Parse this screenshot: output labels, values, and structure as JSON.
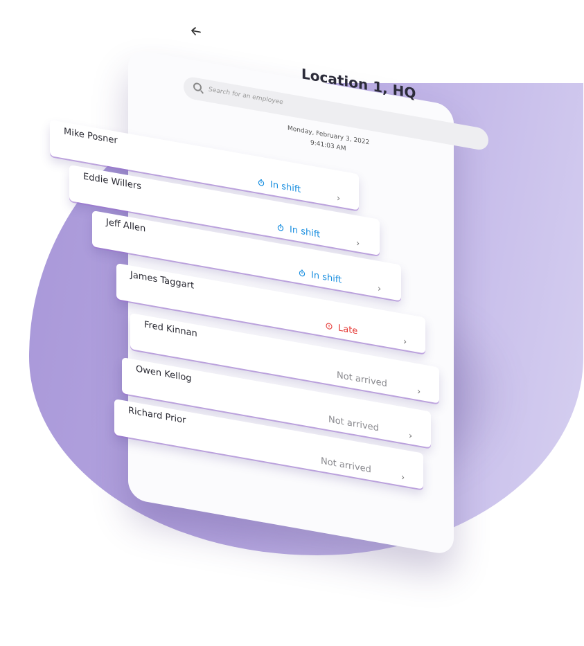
{
  "header": {
    "title": "Location 1, HQ",
    "back_icon": "back-arrow-icon"
  },
  "search": {
    "placeholder": "Search for an employee",
    "icon": "search-icon"
  },
  "datetime": {
    "date": "Monday, February 3, 2022",
    "time": "9:41:03 AM"
  },
  "employees": [
    {
      "name": "Mike Posner",
      "status": "In shift",
      "status_type": "inshift"
    },
    {
      "name": "Eddie Willers",
      "status": "In shift",
      "status_type": "inshift"
    },
    {
      "name": "Jeff Allen",
      "status": "In shift",
      "status_type": "inshift"
    },
    {
      "name": "James Taggart",
      "status": "Late",
      "status_type": "late"
    },
    {
      "name": "Fred Kinnan",
      "status": "Not arrived",
      "status_type": "notarrived"
    },
    {
      "name": "Owen Kellog",
      "status": "Not arrived",
      "status_type": "notarrived"
    },
    {
      "name": "Richard Prior",
      "status": "Not arrived",
      "status_type": "notarrived"
    }
  ],
  "colors": {
    "in_shift": "#1a8fe0",
    "late": "#e53935",
    "not_arrived": "#8a8a8f",
    "background_blob": "#b7a8e2"
  }
}
